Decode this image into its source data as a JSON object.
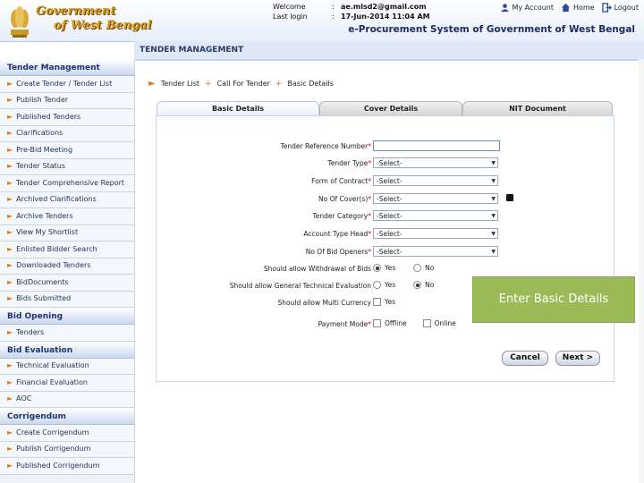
{
  "header": {
    "brand_line1": "Government",
    "brand_line2": "of West Bengal",
    "welcome_label": "Welcome",
    "welcome_value": "ae.mlsd2@gmail.com",
    "last_login_label": "Last login",
    "last_login_value": "17-Jun-2014 11:04 AM",
    "colon": ":",
    "links": {
      "my_account": "My Account",
      "home": "Home",
      "logout": "Logout"
    },
    "system_title": "e-Procurement System of Government of West Bengal"
  },
  "section_title": "TENDER MANAGEMENT",
  "sidebar": {
    "groups": [
      {
        "title": "Tender Management",
        "items": [
          "Create Tender / Tender List",
          "Publish Tender",
          "Published Tenders",
          "Clarifications",
          "Pre-Bid Meeting",
          "Tender Status",
          "Tender Comprehensive Report",
          "Archived Clarifications",
          "Archive Tenders",
          "View My Shortlist",
          "Enlisted Bidder Search",
          "Downloaded Tenders",
          "BidDocuments",
          "Bids Submitted"
        ]
      },
      {
        "title": "Bid Opening",
        "items": [
          "Tenders"
        ]
      },
      {
        "title": "Bid Evaluation",
        "items": [
          "Technical Evaluation",
          "Financial Evaluation",
          "AOC"
        ]
      },
      {
        "title": "Corrigendum",
        "items": [
          "Create Corrigendum",
          "Publish Corrigendum",
          "Published Corrigendum"
        ]
      }
    ]
  },
  "breadcrumb": {
    "items": [
      "Tender List",
      "Call For Tender",
      "Basic Details"
    ],
    "separator": "+"
  },
  "tabs": [
    "Basic Details",
    "Cover Details",
    "NIT Document"
  ],
  "form": {
    "fields": [
      {
        "label": "Tender Reference Number",
        "required": "*",
        "kind": "text",
        "value": ""
      },
      {
        "label": "Tender Type",
        "required": "*",
        "kind": "select",
        "value": "-Select-"
      },
      {
        "label": "Form of Contract",
        "required": "*",
        "kind": "select",
        "value": "-Select-"
      },
      {
        "label": "No Of Cover(s)",
        "required": "*",
        "kind": "select",
        "value": "-Select-"
      },
      {
        "label": "Tender Category",
        "required": "*",
        "kind": "select",
        "value": "-Select-"
      },
      {
        "label": "Account Type Head",
        "required": "*",
        "kind": "select",
        "value": "-Select-"
      },
      {
        "label": "No Of Bid Openers",
        "required": "*",
        "kind": "select",
        "value": "-Select-"
      },
      {
        "label": "Should allow Withdrawal of Bids",
        "required": "",
        "kind": "radio",
        "options": [
          "Yes",
          "No"
        ],
        "selected": "Yes"
      },
      {
        "label": "Should allow General Technical Evaluation",
        "required": "",
        "kind": "radio",
        "options": [
          "Yes",
          "No"
        ],
        "selected": "No"
      },
      {
        "label": "Should allow Multi Currency",
        "required": "",
        "kind": "checkbox",
        "options": [
          "Yes"
        ]
      },
      {
        "label": "Payment Mode",
        "required": "*",
        "kind": "checkbox",
        "options": [
          "Offline",
          "Online"
        ]
      }
    ],
    "dropdown_arrow": "▼",
    "cancel_label": "Cancel",
    "next_label": "Next >"
  },
  "overlay_text": "Enter Basic Details",
  "colors": {
    "accent_orange": "#e07d10",
    "nav_blue": "#1f3470",
    "overlay_green": "#9bbb59"
  }
}
